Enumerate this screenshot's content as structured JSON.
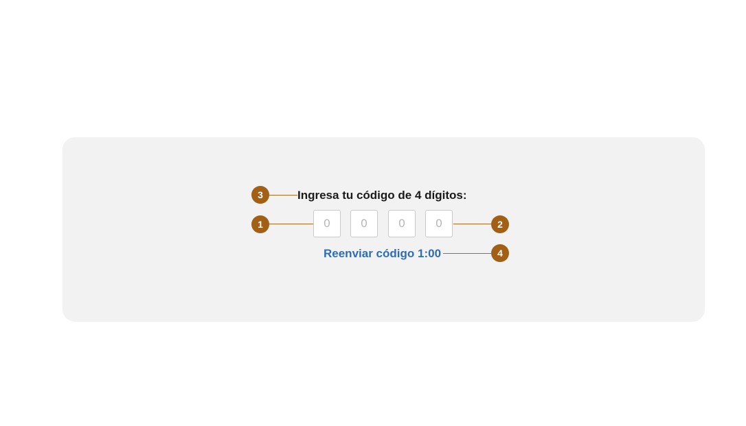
{
  "form": {
    "title": "Ingresa tu código de 4 dígitos:",
    "digits": [
      {
        "value": "",
        "placeholder": "0"
      },
      {
        "value": "",
        "placeholder": "0"
      },
      {
        "value": "",
        "placeholder": "0"
      },
      {
        "value": "",
        "placeholder": "0"
      }
    ],
    "resend_label": "Reenviar código",
    "resend_timer": "1:00"
  },
  "annotations": {
    "markers": [
      {
        "number": "1",
        "target": "digit inputs"
      },
      {
        "number": "2",
        "target": "digit inputs"
      },
      {
        "number": "3",
        "target": "title"
      },
      {
        "number": "4",
        "target": "resend link"
      }
    ],
    "color": "#a25f16"
  },
  "colors": {
    "panel_background": "#f2f2f2",
    "link": "#2e6db4",
    "title_text": "#1a1a1a",
    "input_border": "#c9c9c9"
  }
}
